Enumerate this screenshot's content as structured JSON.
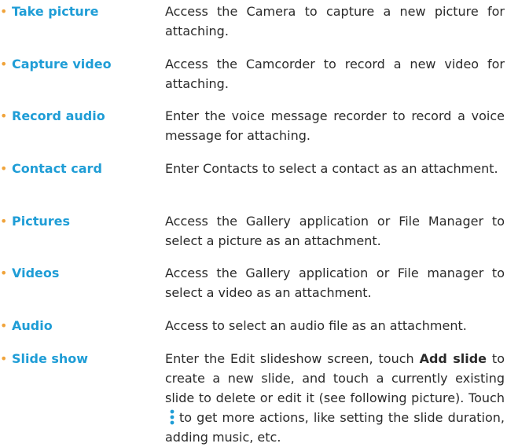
{
  "items": [
    {
      "term": "Take picture",
      "desc": "Access the Camera to capture a new picture for attaching."
    },
    {
      "term": "Capture video",
      "desc": "Access the Camcorder to record a new video for attaching."
    },
    {
      "term": "Record audio",
      "desc": "Enter the voice message recorder to record a voice message for attaching."
    },
    {
      "term": "Contact card",
      "desc": "Enter Contacts to select a contact as an attachment."
    },
    {
      "term": "Pictures",
      "desc": "Access the Gallery application or File Manager to select a picture as an attachment."
    },
    {
      "term": "Videos",
      "desc": "Access the Gallery application or File manager to select a video as an attachment."
    },
    {
      "term": "Audio",
      "desc": "Access to select an audio file as an attachment."
    },
    {
      "term": "Slide show",
      "desc_parts": {
        "p1": "Enter the Edit slideshow screen, touch ",
        "b1": "Add slide",
        "p2": " to create a new slide, and touch a currently existing slide to delete or edit it (see following picture). Touch",
        "p3": "to get more actions, like setting the slide duration, adding music, etc."
      }
    }
  ],
  "bullet_char": "•",
  "colors": {
    "term": "#1f9dd6",
    "bullet": "#f0a33a",
    "text": "#2a2a2a"
  },
  "icons": {
    "more": "more-vertical-icon"
  }
}
